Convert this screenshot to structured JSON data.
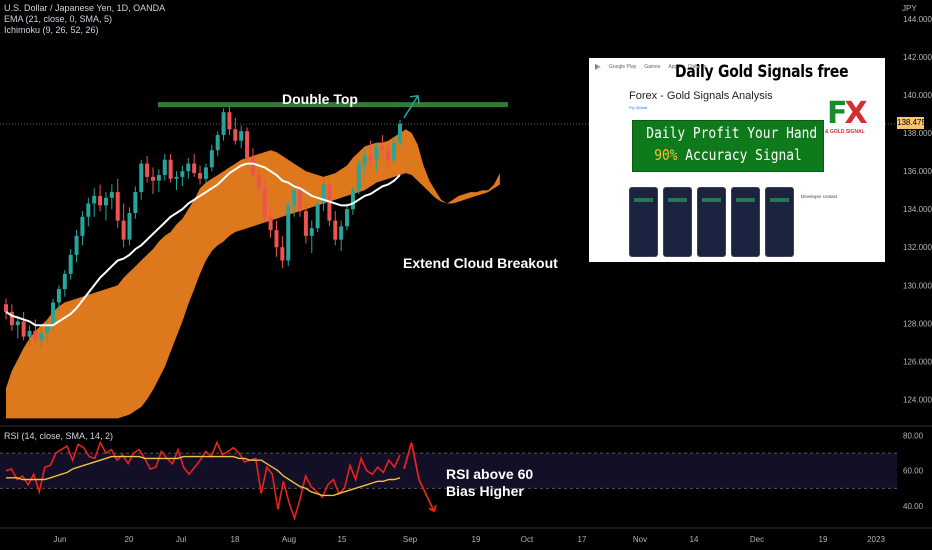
{
  "header": {
    "symbol_line": "U.S. Dollar / Japanese Yen, 1D, OANDA",
    "ema_line": "EMA (21, close, 0, SMA, 5)",
    "ichimoku_line": "Ichimoku (9, 26, 52, 26)",
    "currency": "JPY"
  },
  "annotations": {
    "double_top": "Double Top",
    "cloud_breakout": "Extend Cloud Breakout",
    "rsi_note_1": "RSI  above 60",
    "rsi_note_2": "Bias Higher"
  },
  "price_label": "138.475",
  "rsi_header": "RSI (14, close, SMA, 14, 2)",
  "ad": {
    "store_bar": [
      "Google Play",
      "Games",
      "Apps",
      "Children"
    ],
    "headline": "Daily Gold Signals free",
    "app_title": "Forex - Gold Signals Analysis",
    "developer": "Fly Global",
    "banner_line1": "Daily Profit Your Hand",
    "banner_pct": "90%",
    "banner_line2_rest": " Accuracy Signal",
    "logo_text": "FX",
    "logo_sub": "& GOLD SIGNAL",
    "developer_contact": "Developer contact"
  },
  "colors": {
    "background": "#000000",
    "bull": "#26a69a",
    "bear": "#ef5350",
    "ema": "#ffffff",
    "cloud": "#f0821e",
    "resistance": "#2e7d32",
    "rsi_line": "#e8231a",
    "rsi_ma": "#f0c040"
  },
  "chart_data": [
    {
      "type": "candlestick",
      "title": "U.S. Dollar / Japanese Yen, 1D, OANDA",
      "x_tick_labels": [
        "Jun",
        "20",
        "Jul",
        "18",
        "Aug",
        "15",
        "Sep",
        "19",
        "Oct",
        "17",
        "Nov",
        "14",
        "Dec",
        "19",
        "2023"
      ],
      "y_tick_labels": [
        "124.000",
        "126.000",
        "128.000",
        "130.000",
        "132.000",
        "134.000",
        "136.000",
        "138.000",
        "140.000",
        "142.000",
        "144.000"
      ],
      "ylim": [
        122.6,
        145.0
      ],
      "current_price": 138.475,
      "ohlc": [
        [
          129.0,
          129.3,
          128.2,
          128.6
        ],
        [
          128.6,
          129.0,
          127.6,
          127.9
        ],
        [
          127.9,
          128.4,
          127.2,
          128.1
        ],
        [
          128.1,
          128.6,
          127.1,
          127.3
        ],
        [
          127.3,
          127.9,
          126.8,
          127.6
        ],
        [
          127.6,
          128.2,
          126.9,
          127.1
        ],
        [
          127.1,
          127.8,
          126.7,
          127.5
        ],
        [
          127.5,
          128.2,
          127.0,
          127.9
        ],
        [
          127.9,
          129.3,
          127.7,
          129.1
        ],
        [
          129.1,
          130.0,
          128.6,
          129.8
        ],
        [
          129.8,
          130.8,
          129.4,
          130.6
        ],
        [
          130.6,
          131.9,
          130.3,
          131.6
        ],
        [
          131.6,
          132.9,
          131.2,
          132.6
        ],
        [
          132.6,
          133.9,
          132.1,
          133.6
        ],
        [
          133.6,
          134.6,
          133.1,
          134.3
        ],
        [
          134.3,
          135.1,
          133.6,
          134.7
        ],
        [
          134.7,
          135.3,
          133.9,
          134.2
        ],
        [
          134.2,
          134.9,
          133.4,
          134.6
        ],
        [
          134.6,
          135.3,
          134.0,
          134.9
        ],
        [
          134.9,
          135.6,
          133.0,
          133.4
        ],
        [
          133.4,
          134.3,
          132.0,
          132.4
        ],
        [
          132.4,
          134.1,
          132.1,
          133.8
        ],
        [
          133.8,
          135.2,
          133.5,
          134.9
        ],
        [
          134.9,
          136.6,
          134.5,
          136.4
        ],
        [
          136.4,
          136.8,
          135.4,
          135.7
        ],
        [
          135.7,
          136.2,
          134.8,
          135.5
        ],
        [
          135.5,
          136.1,
          134.9,
          135.8
        ],
        [
          135.8,
          136.9,
          135.5,
          136.6
        ],
        [
          136.6,
          136.9,
          135.4,
          135.6
        ],
        [
          135.6,
          136.0,
          135.0,
          135.7
        ],
        [
          135.7,
          136.3,
          135.2,
          136.0
        ],
        [
          136.0,
          136.7,
          135.6,
          136.4
        ],
        [
          136.4,
          136.9,
          135.7,
          135.9
        ],
        [
          135.9,
          136.3,
          135.3,
          135.6
        ],
        [
          135.6,
          136.4,
          135.4,
          136.2
        ],
        [
          136.2,
          137.4,
          136.0,
          137.1
        ],
        [
          137.1,
          138.1,
          136.8,
          137.9
        ],
        [
          137.9,
          139.3,
          137.6,
          139.1
        ],
        [
          139.1,
          139.4,
          137.9,
          138.2
        ],
        [
          138.2,
          138.8,
          137.4,
          137.6
        ],
        [
          137.6,
          138.4,
          137.2,
          138.1
        ],
        [
          138.1,
          138.3,
          136.4,
          136.7
        ],
        [
          136.7,
          137.2,
          135.6,
          135.8
        ],
        [
          135.8,
          136.1,
          134.8,
          135.1
        ],
        [
          135.1,
          135.5,
          133.3,
          133.6
        ],
        [
          133.6,
          134.2,
          132.5,
          132.9
        ],
        [
          132.9,
          133.4,
          131.5,
          132.0
        ],
        [
          132.0,
          132.6,
          130.9,
          131.3
        ],
        [
          131.3,
          134.4,
          131.0,
          134.2
        ],
        [
          134.2,
          135.3,
          133.6,
          135.0
        ],
        [
          135.0,
          135.4,
          133.6,
          133.9
        ],
        [
          133.9,
          134.4,
          132.2,
          132.6
        ],
        [
          132.6,
          133.4,
          131.7,
          133.0
        ],
        [
          133.0,
          134.6,
          132.8,
          134.3
        ],
        [
          134.3,
          135.6,
          133.9,
          135.3
        ],
        [
          135.3,
          135.6,
          133.1,
          133.4
        ],
        [
          133.4,
          133.9,
          132.1,
          132.4
        ],
        [
          132.4,
          133.4,
          131.8,
          133.1
        ],
        [
          133.1,
          134.3,
          132.9,
          134.0
        ],
        [
          134.0,
          135.2,
          133.7,
          135.0
        ],
        [
          135.0,
          136.6,
          134.8,
          136.4
        ],
        [
          136.4,
          137.1,
          135.9,
          136.8
        ],
        [
          136.8,
          137.6,
          136.2,
          136.6
        ],
        [
          136.6,
          137.5,
          136.0,
          137.3
        ],
        [
          137.3,
          137.9,
          136.8,
          137.1
        ],
        [
          137.1,
          137.4,
          136.2,
          136.6
        ],
        [
          136.6,
          137.7,
          136.4,
          137.5
        ],
        [
          137.5,
          138.7,
          137.3,
          138.5
        ]
      ],
      "ema": [
        128.6,
        128.4,
        128.3,
        128.2,
        128.1,
        127.9,
        127.9,
        127.9,
        127.9,
        128.1,
        128.3,
        128.5,
        128.8,
        129.2,
        129.6,
        130.0,
        130.4,
        130.7,
        131.0,
        131.3,
        131.4,
        131.6,
        131.9,
        132.1,
        132.4,
        132.7,
        133.0,
        133.3,
        133.6,
        133.8,
        134.0,
        134.3,
        134.5,
        134.7,
        134.9,
        135.1,
        135.3,
        135.6,
        135.9,
        136.1,
        136.3,
        136.4,
        136.4,
        136.3,
        136.2,
        136.0,
        135.8,
        135.5,
        135.4,
        135.2,
        135.1,
        134.9,
        134.7,
        134.6,
        134.5,
        134.4,
        134.3,
        134.2,
        134.2,
        134.3,
        134.5,
        134.7,
        134.8,
        135.0,
        135.2,
        135.3,
        135.5,
        135.8
      ],
      "cloud_upper": [
        124.6,
        125.5,
        126.1,
        126.7,
        127.2,
        127.6,
        127.9,
        128.2,
        128.6,
        128.9,
        129.1,
        129.2,
        129.3,
        129.4,
        129.5,
        129.6,
        129.7,
        129.8,
        129.9,
        130.0,
        130.4,
        130.7,
        131.0,
        131.3,
        131.6,
        131.9,
        132.3,
        132.6,
        132.8,
        133.2,
        133.5,
        134.0,
        134.5,
        135.1,
        135.4,
        135.6,
        135.8,
        136.0,
        136.2,
        136.4,
        136.6,
        136.7,
        136.8,
        136.9,
        137.0,
        137.1,
        137.0,
        136.8,
        136.6,
        136.4,
        136.2,
        136.0,
        135.9,
        135.8,
        135.7,
        135.8,
        135.9,
        136.1,
        136.3,
        136.7,
        137.0,
        137.3,
        137.4,
        137.5,
        137.5,
        137.6,
        137.8,
        138.0,
        138.2,
        138.0,
        137.4,
        136.3,
        135.5,
        135.0,
        134.5,
        134.3,
        134.5,
        134.7,
        134.8,
        134.9,
        134.9,
        135.0,
        135.0,
        135.3,
        135.9
      ],
      "cloud_lower": [
        123.0,
        123.0,
        123.0,
        123.0,
        123.0,
        123.0,
        123.0,
        123.0,
        123.0,
        123.0,
        123.0,
        123.0,
        123.0,
        123.0,
        123.0,
        123.0,
        123.0,
        123.0,
        123.0,
        123.0,
        123.1,
        123.2,
        123.4,
        123.6,
        124.0,
        124.5,
        125.1,
        125.7,
        126.5,
        127.3,
        128.1,
        129.0,
        129.8,
        130.6,
        131.3,
        131.8,
        132.1,
        132.3,
        132.6,
        132.8,
        132.9,
        133.0,
        133.1,
        133.2,
        133.3,
        133.4,
        133.5,
        133.6,
        133.7,
        133.8,
        133.9,
        134.0,
        134.1,
        134.2,
        134.3,
        134.4,
        134.5,
        134.6,
        134.7,
        134.8,
        134.9,
        135.0,
        135.2,
        135.4,
        135.5,
        135.6,
        135.7,
        135.8,
        135.9,
        135.8,
        135.5,
        135.2,
        134.9,
        134.6,
        134.4,
        134.3,
        134.3,
        134.4,
        134.5,
        134.6,
        134.7,
        134.8,
        134.9,
        135.1,
        135.3
      ],
      "resistance_level": 139.5
    },
    {
      "type": "line",
      "title": "RSI (14, close, SMA, 14, 2)",
      "y_tick_labels": [
        "40.00",
        "60.00",
        "80.00"
      ],
      "ylim": [
        32,
        82
      ],
      "bands": [
        50,
        70
      ],
      "series": [
        {
          "values": [
            60,
            61,
            55,
            57,
            52,
            58,
            48,
            62,
            63,
            70,
            72,
            74,
            66,
            75,
            73,
            68,
            67,
            76,
            70,
            72,
            66,
            69,
            64,
            70,
            72,
            67,
            61,
            62,
            71,
            67,
            64,
            72,
            62,
            58,
            62,
            66,
            71,
            68,
            76,
            69,
            71,
            73,
            70,
            65,
            66,
            67,
            47,
            62,
            58,
            38,
            54,
            42,
            33,
            44,
            57,
            51,
            48,
            45,
            52,
            55,
            47,
            50,
            63,
            55,
            67,
            60,
            58,
            62,
            59,
            66,
            62,
            69
          ]
        },
        {
          "values": [
            56,
            56,
            56,
            55,
            55,
            55,
            55,
            55,
            56,
            57,
            58,
            59,
            61,
            62,
            63,
            64,
            65,
            66,
            67,
            68,
            68,
            68,
            68,
            68,
            68,
            67,
            67,
            67,
            67,
            67,
            67,
            67,
            68,
            68,
            68,
            68,
            68,
            68,
            68,
            68,
            68,
            68,
            67,
            67,
            66,
            66,
            66,
            64,
            62,
            60,
            57,
            55,
            53,
            51,
            50,
            48,
            47,
            46,
            46,
            46,
            47,
            48,
            49,
            50,
            51,
            52,
            53,
            54,
            54,
            55,
            55,
            56
          ]
        },
        {
          "values": [
            61,
            76,
            55,
            46,
            37
          ]
        }
      ]
    }
  ]
}
